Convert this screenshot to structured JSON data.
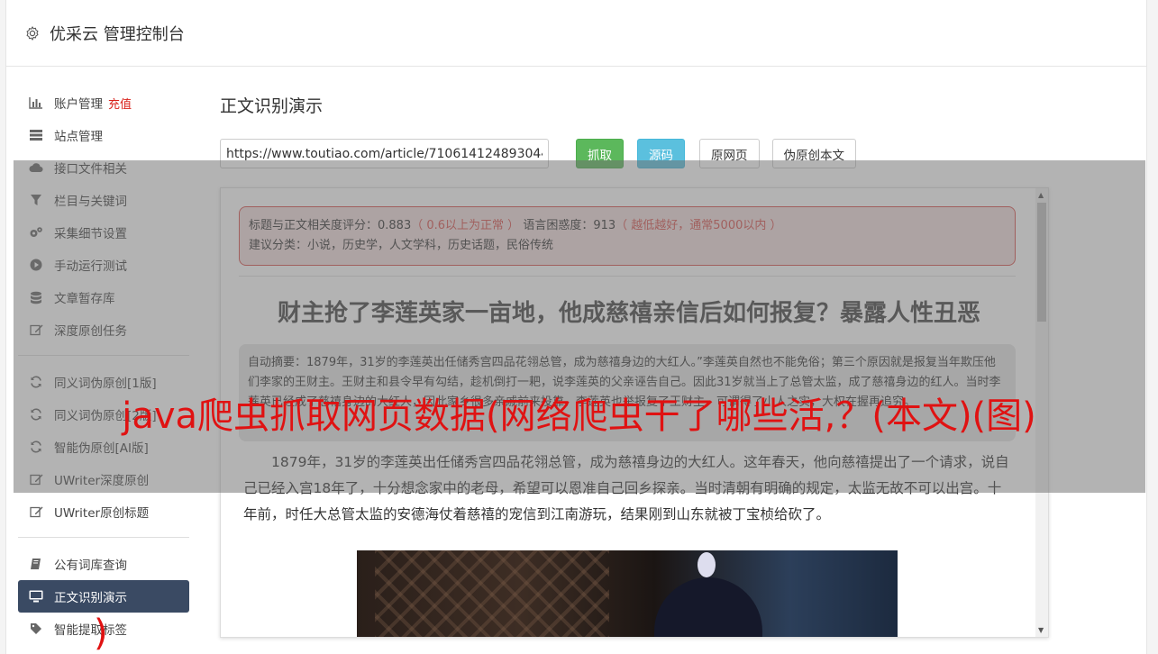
{
  "app": {
    "title": "优采云 管理控制台"
  },
  "sidebar": {
    "items": [
      {
        "label": "账户管理",
        "badge": "充值",
        "icon": "bar-chart-icon"
      },
      {
        "label": "站点管理",
        "icon": "server-icon"
      },
      {
        "label": "接口文件相关",
        "icon": "cloud-upload-icon"
      },
      {
        "label": "栏目与关键词",
        "icon": "filter-icon"
      },
      {
        "label": "采集细节设置",
        "icon": "gears-icon"
      },
      {
        "label": "手动运行测试",
        "icon": "play-circle-icon"
      },
      {
        "label": "文章暂存库",
        "icon": "database-icon"
      },
      {
        "label": "深度原创任务",
        "icon": "edit-icon"
      }
    ],
    "items2": [
      {
        "label": "同义词伪原创[1版]",
        "icon": "refresh-icon"
      },
      {
        "label": "同义词伪原创[2版]",
        "icon": "refresh-icon"
      },
      {
        "label": "智能伪原创[AI版]",
        "icon": "refresh-icon"
      },
      {
        "label": "UWriter深度原创",
        "icon": "edit-icon"
      },
      {
        "label": "UWriter原创标题",
        "icon": "edit-icon"
      }
    ],
    "items3": [
      {
        "label": "公有词库查询",
        "icon": "book-icon"
      },
      {
        "label": "正文识别演示",
        "icon": "monitor-icon"
      },
      {
        "label": "智能提取标签",
        "icon": "tag-icon"
      }
    ]
  },
  "main": {
    "title": "正文识别演示",
    "url": "https://www.toutiao.com/article/7106141248930447",
    "buttons": {
      "grab": "抓取",
      "source": "源码",
      "original": "原网页",
      "spin": "伪原创本文"
    }
  },
  "result": {
    "score_label": "标题与正文相关度评分：0.883",
    "score_note": "（ 0.6以上为正常 ）",
    "perplexity_label": "语言困惑度：913",
    "perplexity_note": "（ 越低越好，通常5000以内 ）",
    "categories": "建议分类：小说，历史学，人文学科，历史话题，民俗传统",
    "article_title": "财主抢了李莲英家一亩地，他成慈禧亲信后如何报复？暴露人性丑恶",
    "summary": "自动摘要：1879年，31岁的李莲英出任储秀宫四品花翎总管，成为慈禧身边的大红人。”李莲英自然也不能免俗；第三个原因就是报复当年欺压他们李家的王财主。王财主和县令早有勾结，趁机倒打一耙，说李莲英的父亲诬告自己。因此31岁就当上了总管太监，成了慈禧身边的红人。当时李莲英已经成了慈禧身边的大红人，因此家乡很多亲戚前来投靠，李莲英也举报复了王财主，可谓得了小人之实，大权在握再追究。",
    "body": "1879年，31岁的李莲英出任储秀宫四品花翎总管，成为慈禧身边的大红人。这年春天，他向慈禧提出了一个请求，说自己已经入宫18年了，十分想念家中的老母，希望可以恩准自己回乡探亲。当时清朝有明确的规定，太监无故不可以出宫。十年前，时任大总管太监的安德海仗着慈禧的宠信到江南游玩，结果刚到山东就被丁宝桢给砍了。"
  },
  "watermark": {
    "line1": "java爬虫抓取网页数据(网络爬虫干了哪些活,？(本文)(图)",
    "line2": ")"
  }
}
